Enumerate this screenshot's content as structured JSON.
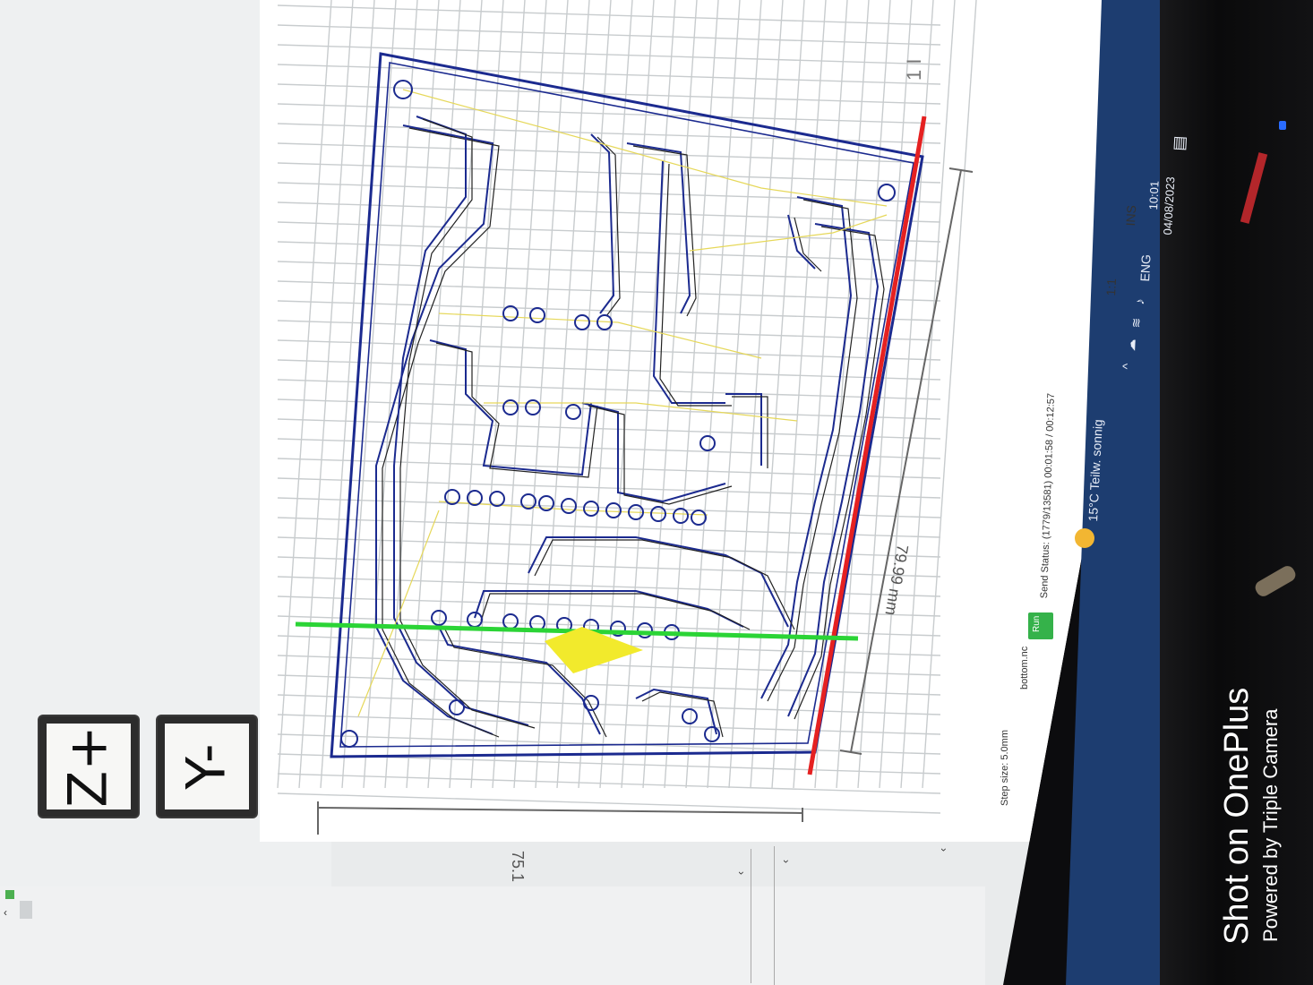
{
  "app": {
    "step_size": "Step size: 5.0mm",
    "file_name": "bottom.nc",
    "run_label": "Run",
    "send_status": "Send Status: (1779/13581) 00:01:58 / 00:12:57"
  },
  "jog_buttons": [
    {
      "label": "Z+"
    },
    {
      "label": "Y-"
    }
  ],
  "visualizer": {
    "width_dimension": "75.1 mm",
    "height_dimension": "79.99 mm",
    "corner_label": "1 I",
    "colors": {
      "trace": "#1b2a8f",
      "yellow_path": "#e6d85a",
      "x_axis": "#e52121",
      "y_axis": "#2bd436",
      "tool": "#f2ea2c",
      "grid": "#c8ccce"
    }
  },
  "taskbar": {
    "weather": "15°C  Teilw. sonnig",
    "ratio": "1:1",
    "ins": "INS",
    "language": "ENG",
    "time": "10:01",
    "date": "04/08/2023",
    "icons": [
      "weather-icon",
      "chevron-up-icon",
      "onedrive-icon",
      "wifi-icon",
      "volume-icon",
      "notification-icon"
    ]
  },
  "watermark": {
    "line1": "Shot on OnePlus",
    "line2": "Powered by Triple Camera"
  }
}
